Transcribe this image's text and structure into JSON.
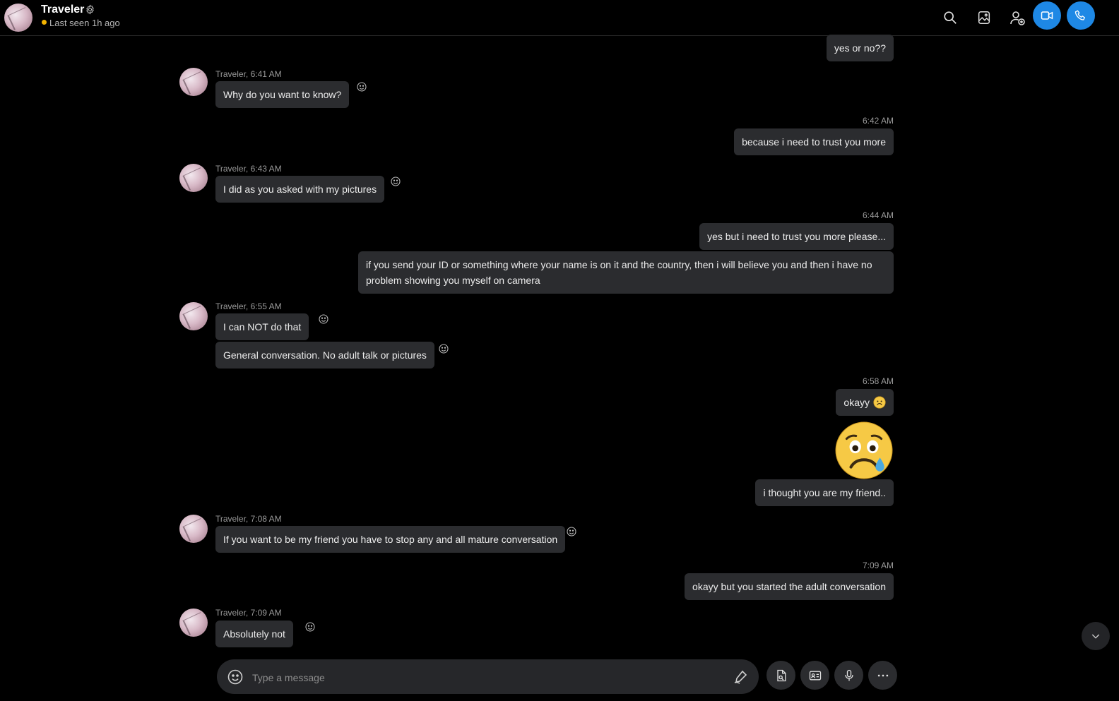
{
  "header": {
    "name": "Traveler",
    "status": "Last seen 1h ago",
    "status_color": "#f4b400",
    "icons": [
      "settings-gear-icon",
      "search-icon",
      "gallery-icon",
      "add-person-icon",
      "video-call-icon",
      "audio-call-icon"
    ],
    "accent": "#1e88e5"
  },
  "messages": {
    "m0": {
      "text": "yes or no??"
    },
    "m1": {
      "meta": "Traveler, 6:41 AM",
      "text": "Why do you want to know?"
    },
    "m2": {
      "time": "6:42 AM",
      "text": "because i need to trust you more"
    },
    "m3": {
      "meta": "Traveler, 6:43 AM",
      "text": "I did as you asked with my pictures"
    },
    "m4": {
      "time": "6:44 AM",
      "text": "yes but i need to trust you more please..."
    },
    "m5": {
      "text": "if you send your ID or something where your name is on it and the country, then i will believe you and then i have no problem showing you myself on camera"
    },
    "m6": {
      "meta": "Traveler, 6:55 AM",
      "text": "I can NOT do that"
    },
    "m7": {
      "text": "General conversation. No adult talk or pictures"
    },
    "m8": {
      "time": "6:58 AM",
      "text": "okayy",
      "emoji": "sad-face-emoji"
    },
    "m9": {
      "emoji": "crying-face-emoji"
    },
    "m10": {
      "text": "i thought you are my friend.."
    },
    "m11": {
      "meta": "Traveler, 7:08 AM",
      "text": "If you want to be my friend you have to stop any and all mature conversation"
    },
    "m12": {
      "time": "7:09 AM",
      "text": "okayy but you started the adult conversation"
    },
    "m13": {
      "meta": "Traveler, 7:09 AM",
      "text": "Absolutely not"
    }
  },
  "composer": {
    "placeholder": "Type a message"
  },
  "colors": {
    "background": "#000000",
    "bubble": "#2b2c2f",
    "meta_text": "#9a9a9a"
  }
}
